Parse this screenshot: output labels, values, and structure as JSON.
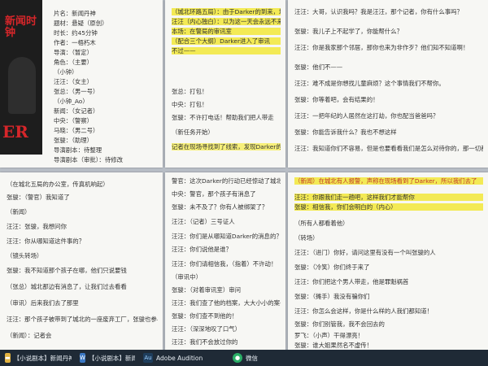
{
  "pages": {
    "a": {
      "lines": [
        "片名：新闻丹神",
        "题材：悬疑（原创）",
        "时长：约45分钟",
        "作者：一梧朽木",
        "导演：（暂定）",
        "角色：（主要）",
        "（小钟）",
        "汪汪：（女主）",
        "张总：（男一号）",
        "（小钟_Ao）",
        "新闻：（女记者）",
        "中央：（警察）",
        "马晓：（男二号）",
        "张骏：（助理）",
        "导演剧本：待整理",
        "导演剧本（审批）：待修改",
        "灯光：待定"
      ],
      "poster_title": "新闻时钟",
      "poster_sub": "ER"
    },
    "b": {
      "lines": [
        "（城北环路五局）：由于Darker的到来，城区有新变化的情况",
        "汪汪（内心独白）：以为这一天会永远不来",
        "本场：在警局的审讯室",
        "（配合三个大纲）Darker进入了审讯",
        "不过——",
        "张总：打包！",
        "中央：打包！",
        "张骏：不许打电话！帮助我们把人带走",
        "（新任务开始）",
        "记者在现场寻找到了线索，发现Darker的痕迹"
      ]
    },
    "c": {
      "lines": [
        "汪汪：大哥，认识我吗？我是汪汪，那个记者，你有什么事吗？",
        "张骏：我儿子上不起学了，你能帮什么？",
        "汪汪：你是我家那个邻居，那你也来为非作歹？他们知不知道啊！",
        "张骏：他们不——",
        "汪汪：难不成是你想找儿童麻烦？这个事情我们不帮你。",
        "张骏：你等着吧，会有结果的！",
        "汪汪：一把年纪的人居然在这打劫，你也配当爸爸吗？",
        "张骏：你能告诉我什么？我也不想这样",
        "汪汪：我知道你们不容易，但是也要看看我们是怎么对待你的，那一切都是为了你好，不要这么想"
      ]
    },
    "d": {
      "lines": [
        "（在城北五局的办公室，传真机响起）",
        "张骏：（警官）我知道了",
        "（新闻）",
        "汪汪：张骏，我想问你",
        "汪汪：你从哪知道这件事的？",
        "（镜头转场）",
        "张骏：我不知道那个孩子在哪，他们只说要钱",
        "（张总）城北那边有消息了，让我们过去看看",
        "（审讯）后来我们去了那里",
        "汪汪：那个孩子被带到了城北的一座废弃工厂，张骏也参与了这件事",
        "（新闻）：记者会"
      ]
    },
    "e": {
      "lines": [
        "警官：这次Darker的行动已经惊动了城北警局，他在哪？",
        "中央：警官，那个孩子有消息了",
        "张骏：未不及了？你有人被绑架了？",
        "汪汪：（记者）三号证人",
        "汪汪：你们是从哪知道Darker的消息的？",
        "汪汪：你们说他是谁？",
        "汪汪：你们请相信我，（指着）不许动！",
        "（审讯中）",
        "张骏：（对着审讯室）审问",
        "汪汪：我们查了他的档案，大大小小的案子都有，这次又被他骗了，我……",
        "张骏：你们查不到他的！",
        "汪汪：（深深地叹了口气）",
        "汪汪：我们不会放过你的"
      ]
    },
    "f": {
      "lines": [
        "（新闻）在城北有人报警，声称在现场看到了Darker，所以我们去了",
        "汪汪：你跟我们走一趟吧，这样我们才能帮你",
        "张骏：相信我，你们会明白的（内心）",
        "（所有人都看着他）",
        "（转场）",
        "汪汪：（进门）你好，请问这里有没有一个叫张骏的人",
        "张骏：（冷笑）你们终于来了",
        "汪汪：你们把这个男人带走，他是罪魁祸首",
        "张骏：（摊手）我没有骗你们",
        "汪汪：你怎么会这样，你是什么样的人我们都知道！",
        "张骏：你们别管我，我不会回去的",
        "罗飞：（小声）干得漂亮！",
        "张骏：谁大姐果然名不虚传！"
      ]
    }
  },
  "taskbar": {
    "items": [
      {
        "label": "【小说剧本】新闻丹神",
        "icon_name": "folder-icon",
        "color": "#e3b341"
      },
      {
        "label": "【小说剧本】新闻...",
        "icon_name": "document-icon",
        "color": "#3b78c4"
      },
      {
        "label": "Adobe Audition",
        "icon_name": "audition-icon",
        "color": "#1e3d5c",
        "glyph": "Au"
      },
      {
        "label": "微信",
        "icon_name": "wechat-icon",
        "color": "#2aae67"
      }
    ]
  }
}
